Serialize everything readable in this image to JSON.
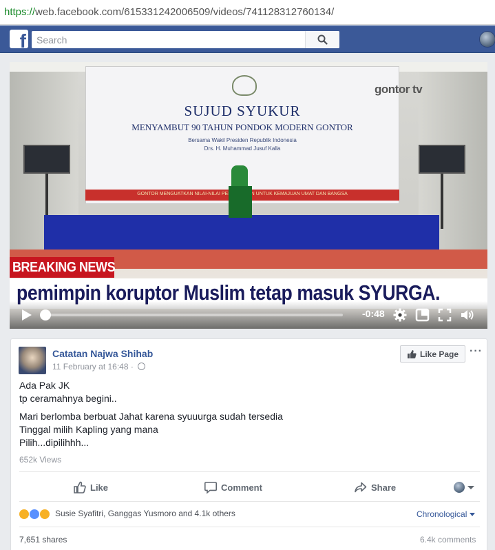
{
  "browser": {
    "url_scheme": "https://",
    "url_rest": "web.facebook.com/615331242006509/videos/741128312760134/"
  },
  "fb": {
    "logo_letter": "f",
    "search_placeholder": "Search",
    "brand_color": "#3b5998"
  },
  "video": {
    "banner_title": "SUJUD SYUKUR",
    "banner_subtitle": "MENYAMBUT 90 TAHUN PONDOK MODERN GONTOR",
    "banner_line3": "Bersama Wakil Presiden Republik Indonesia",
    "banner_line4": "Drs. H. Muhammad Jusuf Kalla",
    "channel_watermark": "gontor tv",
    "red_strip_text": "GONTOR MENGUATKAN NILAI-NILAI PERJUANGAN UNTUK KEMAJUAN UMAT DAN BANGSA",
    "breaking_label": "BREAKING NEWS",
    "ticker_text": "pemimpin koruptor Muslim tetap masuk SYURGA.",
    "time_remaining": "-0:48",
    "progress": 0.0
  },
  "post": {
    "page_name": "Catatan Najwa Shihab",
    "date": "11 February at 16:48 ·",
    "like_page_label": "Like Page",
    "more_label": "···",
    "lines": [
      "Ada Pak JK",
      "tp ceramahnya begini..",
      "Mari berlomba berbuat Jahat karena syuuurga sudah tersedia",
      "Tinggal milih Kapling yang mana",
      "Pilih...dipilihhh..."
    ],
    "views": "652k Views",
    "actions": {
      "like": "Like",
      "comment": "Comment",
      "share": "Share"
    },
    "reactions_text": "Susie Syafitri, Ganggas Yusmoro and 4.1k others",
    "sort_label": "Chronological",
    "shares": "7,651 shares",
    "comments": "6.4k comments",
    "link_color": "#365899"
  }
}
